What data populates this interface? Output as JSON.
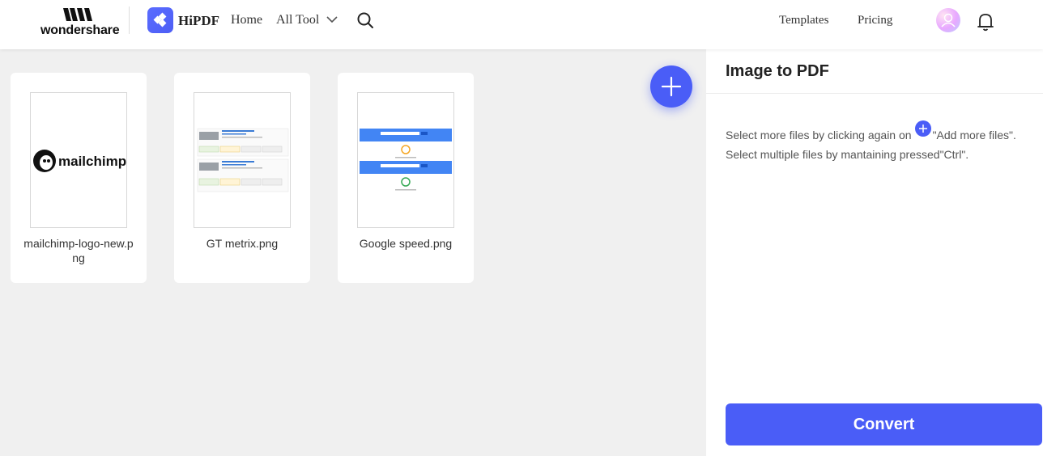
{
  "header": {
    "brand_text": "wondershare",
    "product_name": "HiPDF",
    "nav": {
      "home": "Home",
      "all_tool": "All Tool",
      "templates": "Templates",
      "pricing": "Pricing"
    },
    "icons": [
      "wondershare-logo-icon",
      "hipdf-logo-icon",
      "chevron-down-icon",
      "search-icon",
      "avatar",
      "bell-icon"
    ]
  },
  "files": [
    {
      "name": "mailchimp-logo-new.png",
      "thumb_label": "mailchimp"
    },
    {
      "name": "GT metrix.png"
    },
    {
      "name": "Google speed.png"
    }
  ],
  "panel": {
    "title": "Image to PDF",
    "hint_before": "Select more files by clicking again on",
    "hint_after": "\"Add more files\".",
    "hint2": "Select multiple files by mantaining pressed\"Ctrl\".",
    "convert_label": "Convert"
  },
  "colors": {
    "accent": "#4a5df7",
    "panel_bg": "#ffffff",
    "canvas_bg": "#f0f0f0"
  }
}
